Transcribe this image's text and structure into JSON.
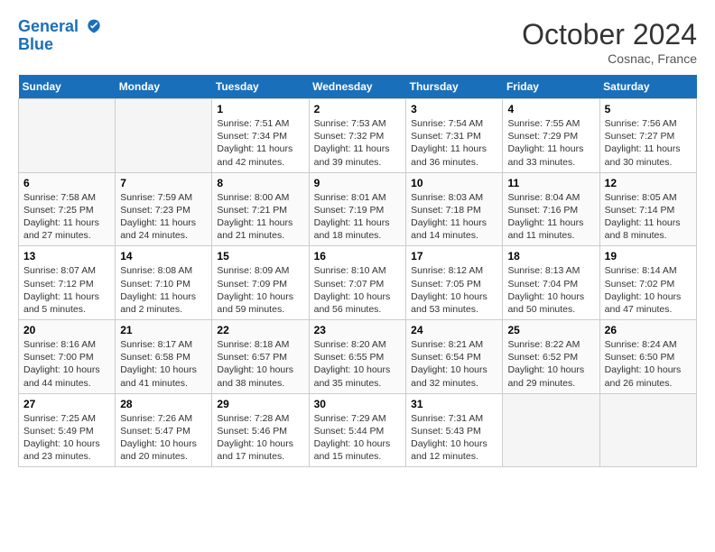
{
  "header": {
    "logo_line1": "General",
    "logo_line2": "Blue",
    "month": "October 2024",
    "location": "Cosnac, France"
  },
  "days_of_week": [
    "Sunday",
    "Monday",
    "Tuesday",
    "Wednesday",
    "Thursday",
    "Friday",
    "Saturday"
  ],
  "weeks": [
    [
      {
        "day": "",
        "empty": true
      },
      {
        "day": "",
        "empty": true
      },
      {
        "day": "1",
        "sunrise": "Sunrise: 7:51 AM",
        "sunset": "Sunset: 7:34 PM",
        "daylight": "Daylight: 11 hours and 42 minutes."
      },
      {
        "day": "2",
        "sunrise": "Sunrise: 7:53 AM",
        "sunset": "Sunset: 7:32 PM",
        "daylight": "Daylight: 11 hours and 39 minutes."
      },
      {
        "day": "3",
        "sunrise": "Sunrise: 7:54 AM",
        "sunset": "Sunset: 7:31 PM",
        "daylight": "Daylight: 11 hours and 36 minutes."
      },
      {
        "day": "4",
        "sunrise": "Sunrise: 7:55 AM",
        "sunset": "Sunset: 7:29 PM",
        "daylight": "Daylight: 11 hours and 33 minutes."
      },
      {
        "day": "5",
        "sunrise": "Sunrise: 7:56 AM",
        "sunset": "Sunset: 7:27 PM",
        "daylight": "Daylight: 11 hours and 30 minutes."
      }
    ],
    [
      {
        "day": "6",
        "sunrise": "Sunrise: 7:58 AM",
        "sunset": "Sunset: 7:25 PM",
        "daylight": "Daylight: 11 hours and 27 minutes."
      },
      {
        "day": "7",
        "sunrise": "Sunrise: 7:59 AM",
        "sunset": "Sunset: 7:23 PM",
        "daylight": "Daylight: 11 hours and 24 minutes."
      },
      {
        "day": "8",
        "sunrise": "Sunrise: 8:00 AM",
        "sunset": "Sunset: 7:21 PM",
        "daylight": "Daylight: 11 hours and 21 minutes."
      },
      {
        "day": "9",
        "sunrise": "Sunrise: 8:01 AM",
        "sunset": "Sunset: 7:19 PM",
        "daylight": "Daylight: 11 hours and 18 minutes."
      },
      {
        "day": "10",
        "sunrise": "Sunrise: 8:03 AM",
        "sunset": "Sunset: 7:18 PM",
        "daylight": "Daylight: 11 hours and 14 minutes."
      },
      {
        "day": "11",
        "sunrise": "Sunrise: 8:04 AM",
        "sunset": "Sunset: 7:16 PM",
        "daylight": "Daylight: 11 hours and 11 minutes."
      },
      {
        "day": "12",
        "sunrise": "Sunrise: 8:05 AM",
        "sunset": "Sunset: 7:14 PM",
        "daylight": "Daylight: 11 hours and 8 minutes."
      }
    ],
    [
      {
        "day": "13",
        "sunrise": "Sunrise: 8:07 AM",
        "sunset": "Sunset: 7:12 PM",
        "daylight": "Daylight: 11 hours and 5 minutes."
      },
      {
        "day": "14",
        "sunrise": "Sunrise: 8:08 AM",
        "sunset": "Sunset: 7:10 PM",
        "daylight": "Daylight: 11 hours and 2 minutes."
      },
      {
        "day": "15",
        "sunrise": "Sunrise: 8:09 AM",
        "sunset": "Sunset: 7:09 PM",
        "daylight": "Daylight: 10 hours and 59 minutes."
      },
      {
        "day": "16",
        "sunrise": "Sunrise: 8:10 AM",
        "sunset": "Sunset: 7:07 PM",
        "daylight": "Daylight: 10 hours and 56 minutes."
      },
      {
        "day": "17",
        "sunrise": "Sunrise: 8:12 AM",
        "sunset": "Sunset: 7:05 PM",
        "daylight": "Daylight: 10 hours and 53 minutes."
      },
      {
        "day": "18",
        "sunrise": "Sunrise: 8:13 AM",
        "sunset": "Sunset: 7:04 PM",
        "daylight": "Daylight: 10 hours and 50 minutes."
      },
      {
        "day": "19",
        "sunrise": "Sunrise: 8:14 AM",
        "sunset": "Sunset: 7:02 PM",
        "daylight": "Daylight: 10 hours and 47 minutes."
      }
    ],
    [
      {
        "day": "20",
        "sunrise": "Sunrise: 8:16 AM",
        "sunset": "Sunset: 7:00 PM",
        "daylight": "Daylight: 10 hours and 44 minutes."
      },
      {
        "day": "21",
        "sunrise": "Sunrise: 8:17 AM",
        "sunset": "Sunset: 6:58 PM",
        "daylight": "Daylight: 10 hours and 41 minutes."
      },
      {
        "day": "22",
        "sunrise": "Sunrise: 8:18 AM",
        "sunset": "Sunset: 6:57 PM",
        "daylight": "Daylight: 10 hours and 38 minutes."
      },
      {
        "day": "23",
        "sunrise": "Sunrise: 8:20 AM",
        "sunset": "Sunset: 6:55 PM",
        "daylight": "Daylight: 10 hours and 35 minutes."
      },
      {
        "day": "24",
        "sunrise": "Sunrise: 8:21 AM",
        "sunset": "Sunset: 6:54 PM",
        "daylight": "Daylight: 10 hours and 32 minutes."
      },
      {
        "day": "25",
        "sunrise": "Sunrise: 8:22 AM",
        "sunset": "Sunset: 6:52 PM",
        "daylight": "Daylight: 10 hours and 29 minutes."
      },
      {
        "day": "26",
        "sunrise": "Sunrise: 8:24 AM",
        "sunset": "Sunset: 6:50 PM",
        "daylight": "Daylight: 10 hours and 26 minutes."
      }
    ],
    [
      {
        "day": "27",
        "sunrise": "Sunrise: 7:25 AM",
        "sunset": "Sunset: 5:49 PM",
        "daylight": "Daylight: 10 hours and 23 minutes."
      },
      {
        "day": "28",
        "sunrise": "Sunrise: 7:26 AM",
        "sunset": "Sunset: 5:47 PM",
        "daylight": "Daylight: 10 hours and 20 minutes."
      },
      {
        "day": "29",
        "sunrise": "Sunrise: 7:28 AM",
        "sunset": "Sunset: 5:46 PM",
        "daylight": "Daylight: 10 hours and 17 minutes."
      },
      {
        "day": "30",
        "sunrise": "Sunrise: 7:29 AM",
        "sunset": "Sunset: 5:44 PM",
        "daylight": "Daylight: 10 hours and 15 minutes."
      },
      {
        "day": "31",
        "sunrise": "Sunrise: 7:31 AM",
        "sunset": "Sunset: 5:43 PM",
        "daylight": "Daylight: 10 hours and 12 minutes."
      },
      {
        "day": "",
        "empty": true
      },
      {
        "day": "",
        "empty": true
      }
    ]
  ]
}
